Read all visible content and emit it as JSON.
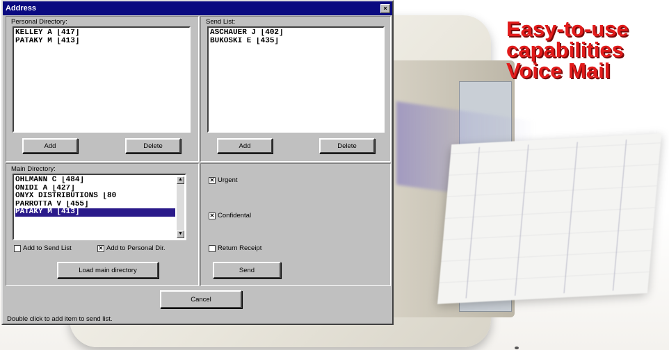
{
  "window": {
    "title": "Address",
    "close_glyph": "×"
  },
  "personal_directory": {
    "label": "Personal Directory:",
    "items": [
      "KELLEY A [417]",
      "PATAKY M [413]"
    ],
    "add_label": "Add",
    "delete_label": "Delete"
  },
  "send_list": {
    "label": "Send List:",
    "items": [
      "ASCHAUER J [402]",
      "BUKOSKI E [435]"
    ],
    "add_label": "Add",
    "delete_label": "Delete"
  },
  "main_directory": {
    "label": "Main Directory:",
    "items": [
      "OHLMANN C [484]",
      "ONIDI A [427]",
      "ONYX DISTRIBUTIONS [80",
      "PARROTTA V [455]",
      "PATAKY M [413]"
    ],
    "selected": "PATAKY M [413]",
    "add_to_send_list_label": "Add to Send List",
    "add_to_send_list_checked": false,
    "add_to_personal_label": "Add to Personal Dir.",
    "add_to_personal_checked": true,
    "load_label": "Load main directory"
  },
  "options": {
    "urgent_label": "Urgent",
    "urgent_checked": true,
    "confidential_label": "Confidental",
    "confidential_checked": true,
    "return_receipt_label": "Return Receipt",
    "return_receipt_checked": false,
    "send_label": "Send"
  },
  "cancel_label": "Cancel",
  "status_text": "Double click to add item to send list.",
  "headline": [
    "Easy-to-use",
    "capabilities",
    "Voice Mail"
  ],
  "colors": {
    "title_bar": "#0a0a80",
    "selection": "#2a1a8a",
    "headline": "#e21b1b",
    "dialog": "#c0c0c0"
  }
}
